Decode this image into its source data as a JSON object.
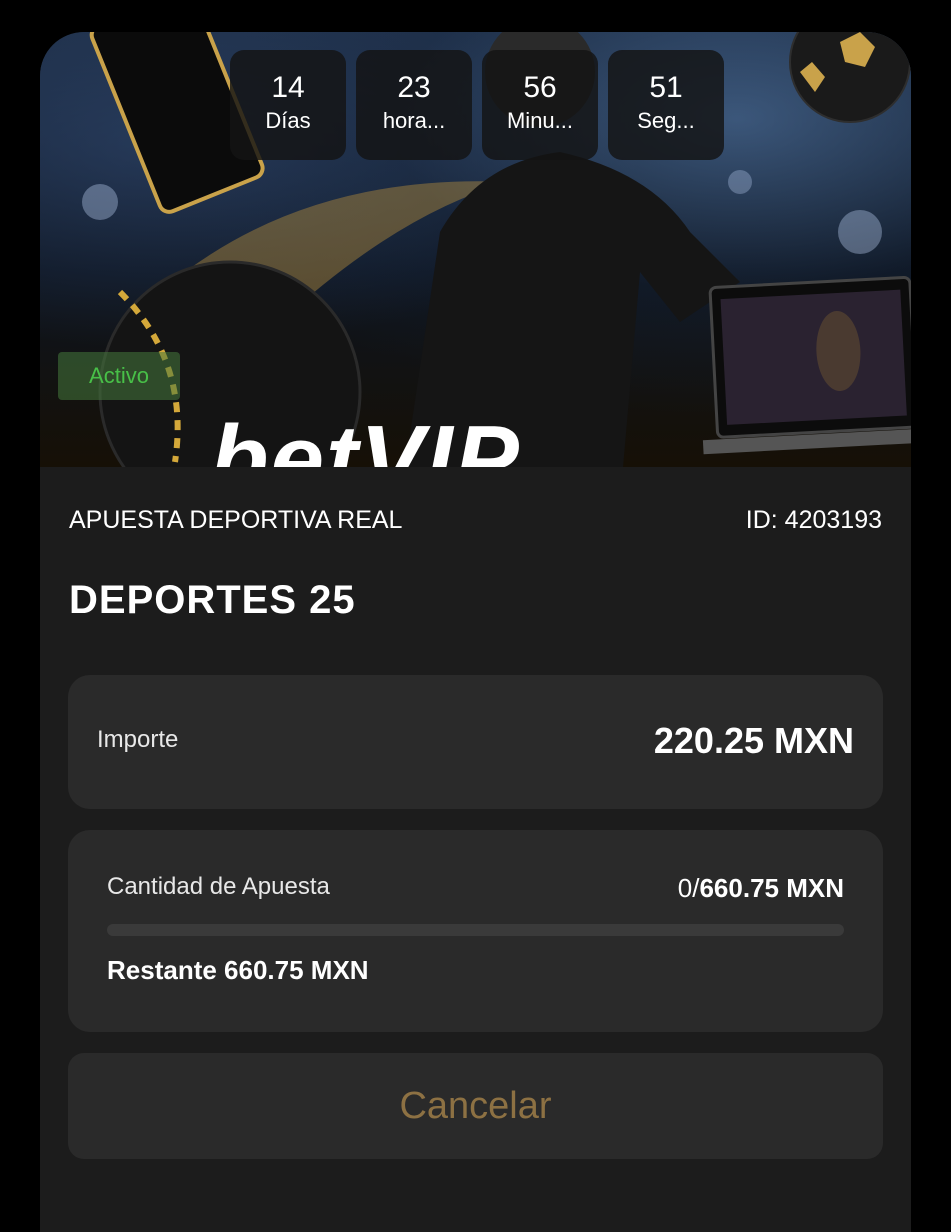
{
  "countdown": [
    {
      "value": "14",
      "unit": "Días"
    },
    {
      "value": "23",
      "unit": "hora..."
    },
    {
      "value": "56",
      "unit": "Minu..."
    },
    {
      "value": "51",
      "unit": "Seg..."
    }
  ],
  "banner": {
    "status_badge": "Activo",
    "brand_text": "betVIP"
  },
  "bet": {
    "type_label": "APUESTA DEPORTIVA REAL",
    "id_label": "ID: 4203193",
    "title": "DEPORTES 25"
  },
  "importe": {
    "label": "Importe",
    "value": "220.25 MXN"
  },
  "apuesta": {
    "label": "Cantidad de Apuesta",
    "current": "0/",
    "total": "660.75 MXN",
    "progress_fraction": 0,
    "remaining": "Restante 660.75 MXN"
  },
  "actions": {
    "cancel_label": "Cancelar"
  },
  "colors": {
    "background": "#000000",
    "card": "#1c1c1c",
    "panel": "#2a2a2a",
    "cancel_text": "#8d7143",
    "status_green": "#48c048"
  }
}
